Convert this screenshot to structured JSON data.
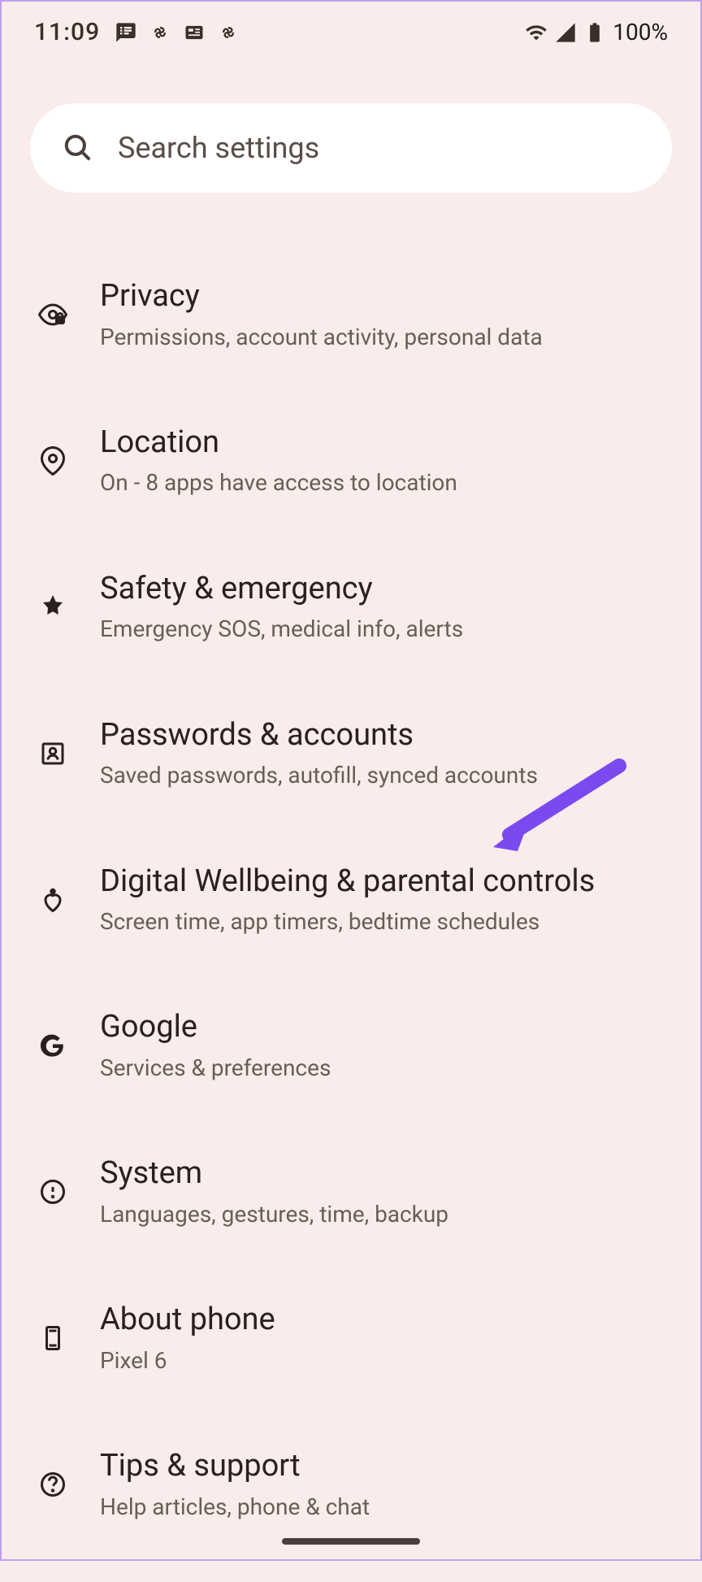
{
  "statusBar": {
    "time": "11:09",
    "batteryPercent": "100%"
  },
  "search": {
    "placeholder": "Search settings"
  },
  "settings": [
    {
      "title": "Privacy",
      "subtitle": "Permissions, account activity, personal data"
    },
    {
      "title": "Location",
      "subtitle": "On - 8 apps have access to location"
    },
    {
      "title": "Safety & emergency",
      "subtitle": "Emergency SOS, medical info, alerts"
    },
    {
      "title": "Passwords & accounts",
      "subtitle": "Saved passwords, autofill, synced accounts"
    },
    {
      "title": "Digital Wellbeing & parental controls",
      "subtitle": "Screen time, app timers, bedtime schedules"
    },
    {
      "title": "Google",
      "subtitle": "Services & preferences"
    },
    {
      "title": "System",
      "subtitle": "Languages, gestures, time, backup"
    },
    {
      "title": "About phone",
      "subtitle": "Pixel 6"
    },
    {
      "title": "Tips & support",
      "subtitle": "Help articles, phone & chat"
    }
  ]
}
